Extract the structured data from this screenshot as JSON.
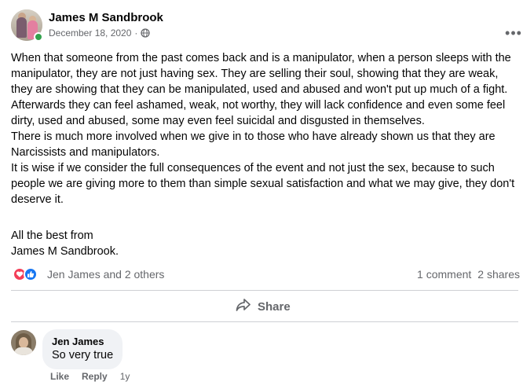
{
  "post": {
    "author": "James M Sandbrook",
    "date": "December 18, 2020",
    "separator": "·",
    "more_label": "•••",
    "paragraphs": [
      "When that someone from the past comes back and is a manipulator, when a person sleeps with the manipulator, they are not just having sex. They are selling their soul, showing that they are weak, they are showing that they can be manipulated, used and abused and won't put up much of a fight.",
      "Afterwards they can feel ashamed, weak, not worthy, they will lack confidence and even some feel dirty, used and abused, some may even feel suicidal and disgusted in themselves.",
      "There is much more involved when we give in to those who have already shown us that they are Narcissists and manipulators.",
      "It is wise if we consider the full consequences of the event and not just the sex, because to such people we are giving more to them than simple sexual satisfaction and what we may give, they don't deserve it."
    ],
    "signoff": [
      "All the best from",
      "James M Sandbrook."
    ]
  },
  "engagement": {
    "reactors": "Jen James and 2 others",
    "comments": "1 comment",
    "shares": "2 shares",
    "share_label": "Share",
    "reaction_icons": [
      "love-icon",
      "like-icon"
    ]
  },
  "comment": {
    "author": "Jen James",
    "text": "So very true",
    "like_label": "Like",
    "reply_label": "Reply",
    "age": "1y"
  },
  "colors": {
    "secondary_text": "#65676b",
    "love": "#f33e58",
    "like": "#1877f2",
    "online": "#31a24c",
    "bubble": "#f0f2f5"
  }
}
